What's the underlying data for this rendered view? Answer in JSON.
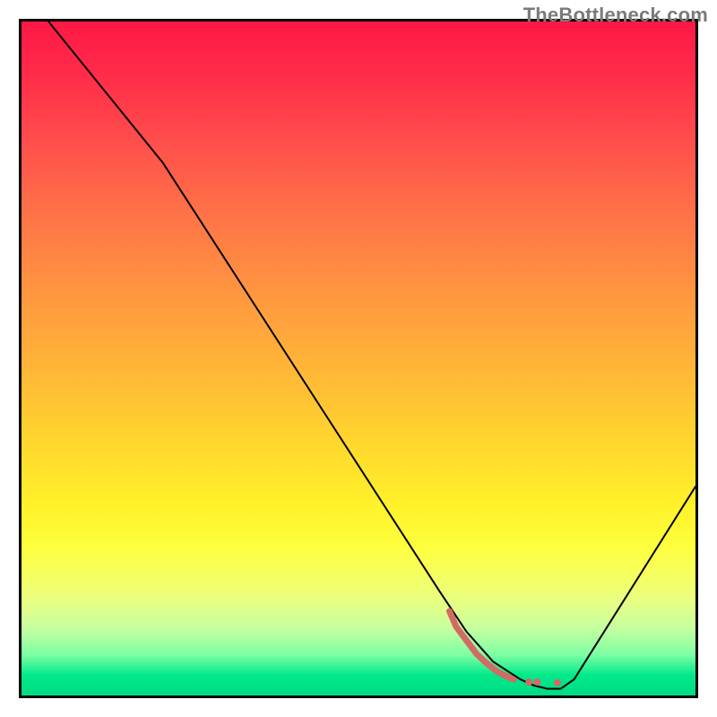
{
  "watermark": "TheBottleneck.com",
  "chart_data": {
    "type": "line",
    "title": "",
    "xlabel": "",
    "ylabel": "",
    "x_range": [
      0,
      100
    ],
    "y_range": [
      0,
      100
    ],
    "series": [
      {
        "name": "curve",
        "color": "#000000",
        "width": 2,
        "points": [
          [
            4,
            100
          ],
          [
            21,
            79
          ],
          [
            62,
            15.5
          ],
          [
            66,
            9.5
          ],
          [
            70,
            5
          ],
          [
            74,
            2.4
          ],
          [
            76,
            1.5
          ],
          [
            78,
            1.0
          ],
          [
            80,
            1.0
          ],
          [
            82,
            2.4
          ],
          [
            100,
            31
          ]
        ]
      },
      {
        "name": "highlight",
        "color": "#d36a64",
        "width": 7,
        "points": [
          [
            63.5,
            12.5
          ],
          [
            64.5,
            10.2
          ],
          [
            66,
            8.2
          ],
          [
            67.5,
            6.2
          ],
          [
            69,
            4.8
          ],
          [
            70.5,
            3.6
          ],
          [
            72,
            2.8
          ],
          [
            73,
            2.4
          ]
        ]
      }
    ],
    "dots": {
      "name": "highlight-dots",
      "color": "#d36a64",
      "radius": 4,
      "points": [
        [
          75.3,
          2.0
        ],
        [
          76.5,
          2.0
        ],
        [
          79.5,
          1.9
        ]
      ]
    },
    "gradient_stops": [
      {
        "offset": 0,
        "color": "#ff1846"
      },
      {
        "offset": 50,
        "color": "#ffdb2c"
      },
      {
        "offset": 95,
        "color": "#00e98a"
      },
      {
        "offset": 100,
        "color": "#00dc84"
      }
    ]
  }
}
